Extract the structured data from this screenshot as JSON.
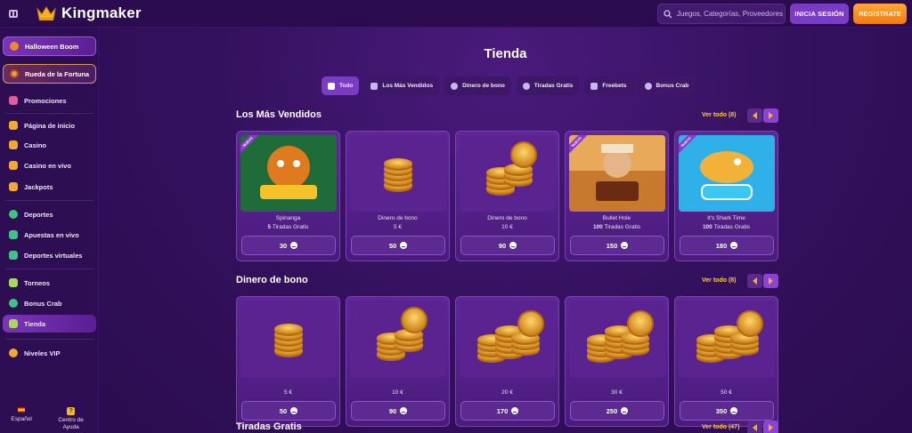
{
  "header": {
    "brand": "Kingmaker",
    "search_placeholder": "Juegos, Categorías, Proveedores",
    "login_label": "INICIA SESIÓN",
    "register_label": "REGÍSTRATE"
  },
  "sidebar": {
    "promos": [
      {
        "label": "Halloween Boom",
        "icon": "pumpkin-icon"
      },
      {
        "label": "Rueda de la Fortuna",
        "icon": "wheel-icon"
      }
    ],
    "items": [
      {
        "label": "Promociones",
        "icon": "gift-icon",
        "color": "#e05c9a"
      },
      {
        "label": "Página de inicio",
        "icon": "home-icon",
        "color": "#f2a930"
      },
      {
        "label": "Casino",
        "icon": "slot-icon",
        "color": "#f2a930"
      },
      {
        "label": "Casino en vivo",
        "icon": "live-casino-icon",
        "color": "#f2a930"
      },
      {
        "label": "Jackpots",
        "icon": "jackpot-icon",
        "color": "#f2a930"
      },
      {
        "label": "Deportes",
        "icon": "soccer-icon",
        "color": "#3fc28a"
      },
      {
        "label": "Apuestas en vivo",
        "icon": "live-bet-icon",
        "color": "#3fc28a"
      },
      {
        "label": "Deportes virtuales",
        "icon": "gamepad-icon",
        "color": "#3fc28a"
      },
      {
        "label": "Torneos",
        "icon": "trophy-icon",
        "color": "#a9d85a"
      },
      {
        "label": "Bonus Crab",
        "icon": "crab-icon",
        "color": "#3fc28a"
      },
      {
        "label": "Tienda",
        "icon": "shop-icon",
        "color": "#a9d85a"
      },
      {
        "label": "Niveles VIP",
        "icon": "vip-icon",
        "color": "#f2a930"
      }
    ],
    "footer": {
      "language": "Español",
      "help": "Centro de Ayuda"
    }
  },
  "main": {
    "title": "Tienda",
    "tabs": [
      {
        "label": "Todo",
        "icon": "bag-icon"
      },
      {
        "label": "Los Más Vendidos",
        "icon": "star-icon"
      },
      {
        "label": "Dinero de bono",
        "icon": "money-icon"
      },
      {
        "label": "Tiradas Gratis",
        "icon": "spin-icon"
      },
      {
        "label": "Freebets",
        "icon": "ticket-icon"
      },
      {
        "label": "Bonus Crab",
        "icon": "crab-icon"
      }
    ],
    "sections": [
      {
        "title": "Los Más Vendidos",
        "see_all": "Ver todo (8)",
        "cards": [
          {
            "name": "Spinanga",
            "sub_num": "5",
            "sub_text": " Tiradas Gratis",
            "price": "30",
            "art": "spinanga",
            "badge": "NUEVO"
          },
          {
            "name": "Dinero de bono",
            "sub_num": "",
            "sub_text": "5 €",
            "price": "50",
            "art": "coins1"
          },
          {
            "name": "Dinero de bono",
            "sub_num": "",
            "sub_text": "10 €",
            "price": "90",
            "art": "coins2"
          },
          {
            "name": "Bullet Hole",
            "sub_num": "100",
            "sub_text": " Tiradas Gratis",
            "price": "150",
            "art": "bullet",
            "badge": "NUEVO"
          },
          {
            "name": "It's Shark Time",
            "sub_num": "100",
            "sub_text": " Tiradas Gratis",
            "price": "180",
            "art": "shark",
            "badge": "NUEVO"
          }
        ]
      },
      {
        "title": "Dinero de bono",
        "see_all": "Ver todo (8)",
        "cards": [
          {
            "name": "5 €",
            "price": "50",
            "art": "coins1"
          },
          {
            "name": "10 €",
            "price": "90",
            "art": "coins2"
          },
          {
            "name": "20 €",
            "price": "170",
            "art": "coins3"
          },
          {
            "name": "30 €",
            "price": "250",
            "art": "coins3"
          },
          {
            "name": "50 €",
            "price": "350",
            "art": "coins3"
          }
        ]
      },
      {
        "title": "Tiradas Gratis",
        "see_all": "Ver todo (47)"
      }
    ]
  }
}
